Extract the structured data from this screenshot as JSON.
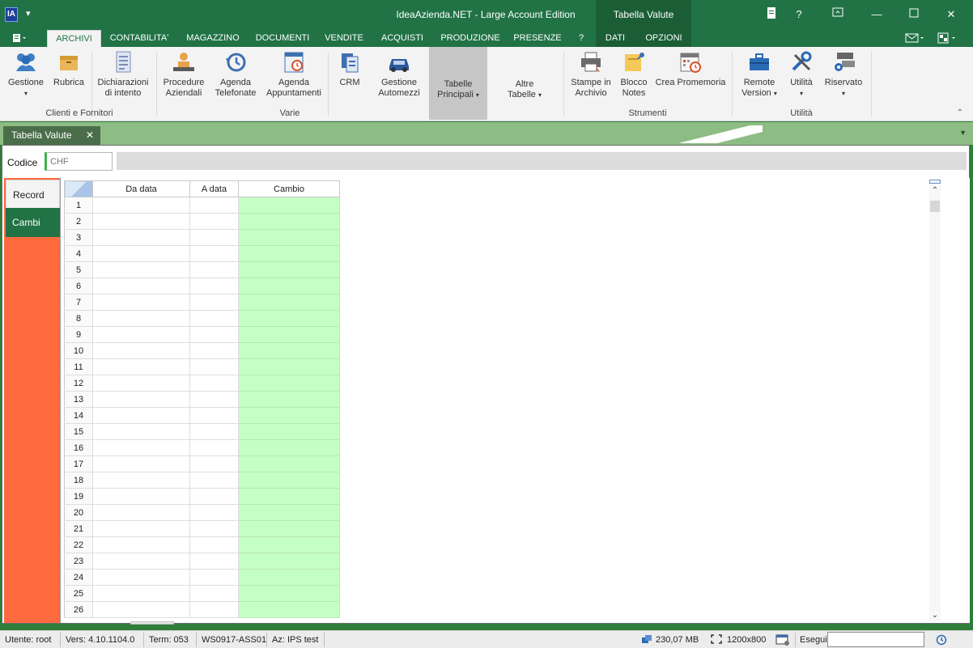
{
  "window": {
    "title": "IdeaAzienda.NET - Large Account Edition",
    "context_tab_title": "Tabella Valute",
    "icon_label": "IA"
  },
  "menu_tabs": [
    "ARCHIVI",
    "CONTABILITA'",
    "MAGAZZINO",
    "DOCUMENTI",
    "VENDITE",
    "ACQUISTI",
    "PRODUZIONE",
    "PRESENZE",
    "?",
    "DATI",
    "OPZIONI"
  ],
  "ribbon": {
    "gestione": "Gestione",
    "rubrica": "Rubrica",
    "dichiarazioni_1": "Dichiarazioni",
    "dichiarazioni_2": "di intento",
    "group_clienti": "Clienti e Fornitori",
    "procedure_1": "Procedure",
    "procedure_2": "Aziendali",
    "agenda_tel_1": "Agenda",
    "agenda_tel_2": "Telefonate",
    "agenda_app_1": "Agenda",
    "agenda_app_2": "Appuntamenti",
    "group_varie": "Varie",
    "crm": "CRM",
    "gestione_auto_1": "Gestione",
    "gestione_auto_2": "Automezzi",
    "tabelle_1": "Tabelle",
    "tabelle_2": "Principali",
    "altre_1": "Altre",
    "altre_2": "Tabelle",
    "stampe_1": "Stampe in",
    "stampe_2": "Archivio",
    "blocco_1": "Blocco",
    "blocco_2": "Notes",
    "promemoria": "Crea Promemoria",
    "group_strumenti": "Strumenti",
    "remote_1": "Remote",
    "remote_2": "Version",
    "utilita": "Utilità",
    "riservato": "Riservato",
    "group_utilita": "Utilità"
  },
  "document_tab": "Tabella Valute",
  "form": {
    "codice_label": "Codice",
    "codice_value": "CHF"
  },
  "side_tabs": {
    "record": "Record",
    "cambi": "Cambi"
  },
  "grid": {
    "columns": [
      "Da data",
      "A data",
      "Cambio"
    ],
    "rows": [
      "1",
      "2",
      "3",
      "4",
      "5",
      "6",
      "7",
      "8",
      "9",
      "10",
      "11",
      "12",
      "13",
      "14",
      "15",
      "16",
      "17",
      "18",
      "19",
      "20",
      "21",
      "22",
      "23",
      "24",
      "25",
      "26"
    ]
  },
  "status": {
    "utente": "Utente: root",
    "versione": "Vers: 4.10.1104.0",
    "term": "Term: 053",
    "workstation": "WS0917-ASS01",
    "azienda": "Az: IPS test",
    "memory": "230,07 MB",
    "resolution": "1200x800",
    "esegui": "Esegui"
  },
  "colors": {
    "accent_green": "#217346",
    "side_panel_orange": "#ff6a3f",
    "cambio_column": "#c4ffc4"
  }
}
